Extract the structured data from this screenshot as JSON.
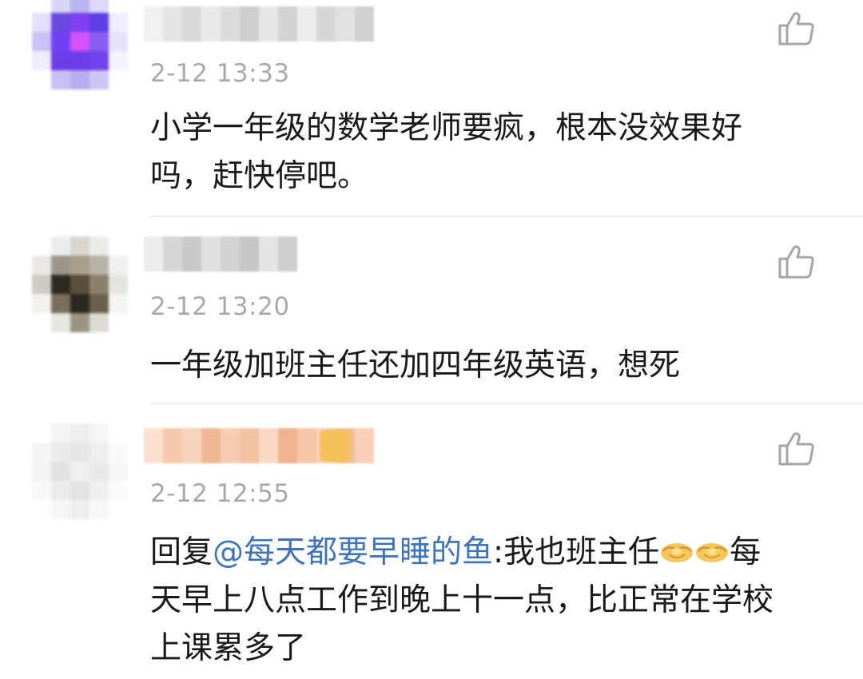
{
  "comments": [
    {
      "username": "",
      "time": "2-12 13:33",
      "lines": [
        "小学一年级的数学老师要疯，根本没效果好",
        "吗，赶快停吧。"
      ],
      "avatar_colors": [
        "#ffffff",
        "#d9d6f5",
        "#b9b3f0",
        "#dcdaf7",
        "#ffffff",
        "#e2e0fa",
        "#6a4be0",
        "#7d3ff0",
        "#5c3fe6",
        "#eeeefc",
        "#c9c2f5",
        "#7040f3",
        "#d253f6",
        "#8a5cf4",
        "#e7e2fb",
        "#ededfb",
        "#6b3ee9",
        "#6b3ee9",
        "#7142ee",
        "#f3f2fd",
        "#ffffff",
        "#c8bff2",
        "#b7acf0",
        "#cdc6f3",
        "#ffffff"
      ],
      "name_colors": [
        "#f0f0f0",
        "#e4e4e4",
        "#d9d9d9",
        "#e9e9e9",
        "#dcdcdc",
        "#cfcfcf",
        "#e6e6e6",
        "#d3d3d3",
        "#ececec",
        "#d6d6d6",
        "#e1e1e1",
        "#d0d0d0"
      ]
    },
    {
      "username": "",
      "time": "2-12 13:20",
      "lines": [
        "一年级加班主任还加四年级英语，想死"
      ],
      "avatar_colors": [
        "#ffffff",
        "#ececec",
        "#d8d5cf",
        "#ecebe7",
        "#ffffff",
        "#e9e8e4",
        "#9d9688",
        "#a89f8b",
        "#b8b3a7",
        "#f1f0ee",
        "#cfcbc2",
        "#2e2a22",
        "#5a4f3c",
        "#8a806d",
        "#e6e4df",
        "#f2f1ef",
        "#7a6e59",
        "#2c2820",
        "#6b604c",
        "#f5f4f2",
        "#ffffff",
        "#e7e6e1",
        "#9c9483",
        "#dedbd4",
        "#ffffff"
      ],
      "name_colors": [
        "#ececec",
        "#d6d6d6",
        "#c9c9c9",
        "#e0e0e0",
        "#d2d2d2",
        "#c6c6c6",
        "#e4e4e4",
        "#cfcfcf"
      ]
    },
    {
      "username": "",
      "time": "2-12 12:55",
      "reply_prefix": "回复",
      "mention": "@每天都要早睡的鱼",
      "line1_rest": ":我也班主任",
      "line1_end": "每",
      "lines_rest": [
        "天早上八点工作到晚上十一点，比正常在学校",
        "上课累多了"
      ],
      "emoji_names": [
        "handshake-emoji",
        "handshake-emoji"
      ],
      "avatar_colors": [
        "#ffffff",
        "#f4f4f4",
        "#eeeeee",
        "#f6f6f6",
        "#ffffff",
        "#f5f5f5",
        "#ebebeb",
        "#e6e6e6",
        "#eeeeee",
        "#fafafa",
        "#f3f3f3",
        "#e2e2e2",
        "#f0f0f0",
        "#e9e9e9",
        "#f7f7f7",
        "#f8f8f8",
        "#ececec",
        "#e4e4e4",
        "#efefef",
        "#fbfbfb",
        "#ffffff",
        "#f6f6f6",
        "#eeeeee",
        "#f7f7f7",
        "#ffffff"
      ],
      "name_colors": [
        "#fbe0cf",
        "#f5c9ad",
        "#f8d4bd",
        "#f0b896",
        "#f6cdb2",
        "#f3c2a3",
        "#f9d9c6",
        "#efb48f",
        "#f4c5a7",
        "#f8d3bc",
        "#f1bd9c",
        "#f7d0b7"
      ]
    }
  ],
  "icons": {
    "like": "thumbs-up-icon"
  },
  "colors": {
    "timestamp": "#a9a9a9",
    "mention": "#3f74b8",
    "text": "#1a1a1a",
    "divider": "#ececec"
  }
}
